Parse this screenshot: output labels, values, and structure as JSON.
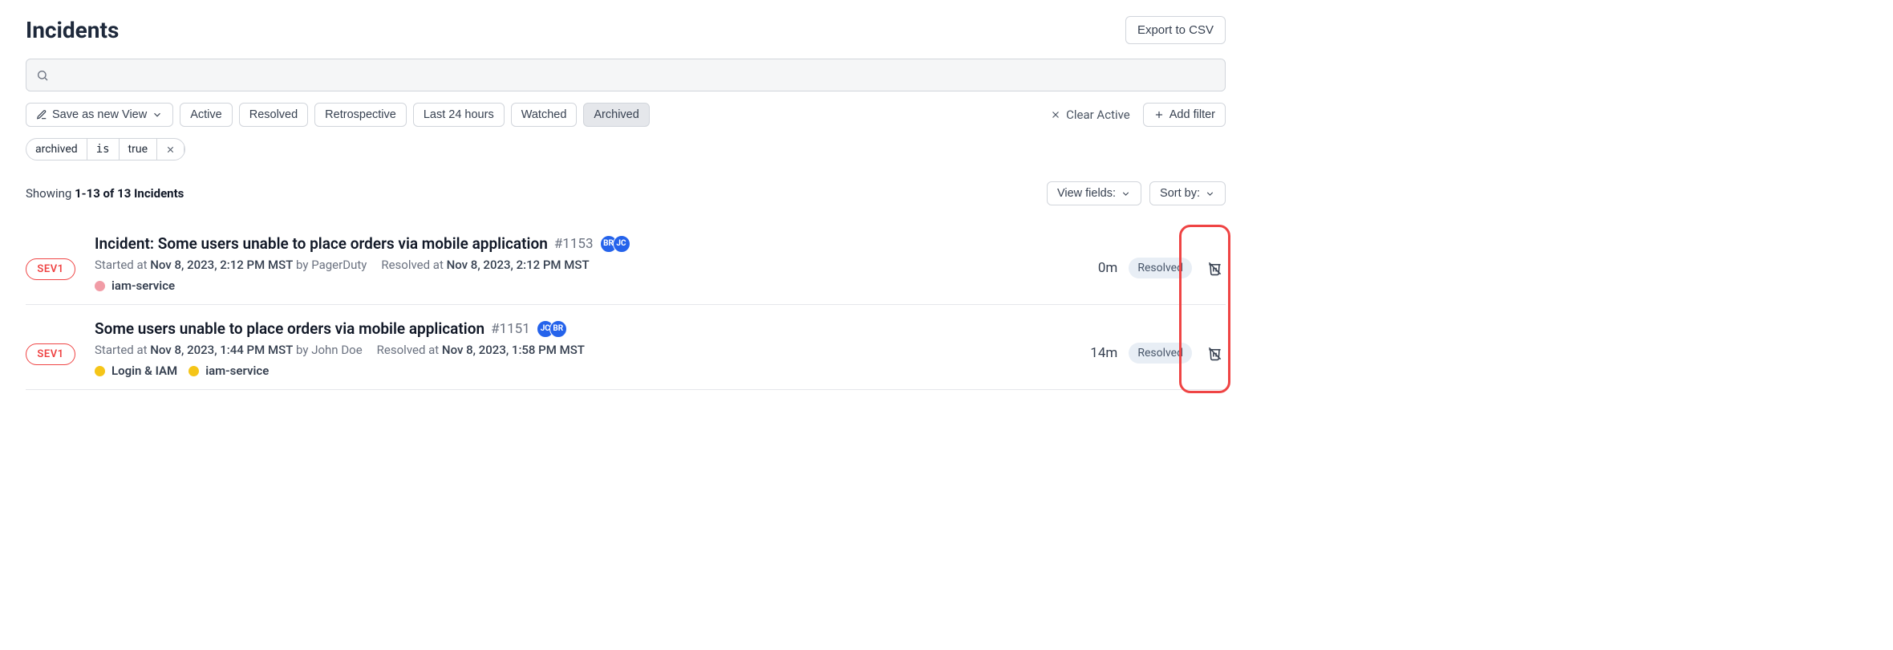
{
  "header": {
    "title": "Incidents",
    "export_label": "Export to CSV"
  },
  "search": {
    "placeholder": ""
  },
  "toolbar": {
    "save_view_label": "Save as new View",
    "preset_filters": [
      "Active",
      "Resolved",
      "Retrospective",
      "Last 24 hours",
      "Watched",
      "Archived"
    ],
    "active_preset_index": 5,
    "clear_label": "Clear Active",
    "add_filter_label": "Add filter"
  },
  "applied_filters": [
    {
      "field": "archived",
      "op": "is",
      "value": "true"
    }
  ],
  "results": {
    "showing_prefix": "Showing ",
    "range": "1-13 of 13 Incidents",
    "view_fields_label": "View fields:",
    "sort_by_label": "Sort by:"
  },
  "incidents": [
    {
      "severity": "SEV1",
      "title": "Incident: Some users unable to place orders via mobile application",
      "id": "#1153",
      "avatars": [
        {
          "initials": "BR",
          "color": "#2563eb"
        },
        {
          "initials": "JC",
          "color": "#2563eb"
        }
      ],
      "started_label": "Started at",
      "started_value": "Nov 8, 2023, 2:12 PM MST",
      "by_label": "by",
      "by_value": "PagerDuty",
      "resolved_label": "Resolved at",
      "resolved_value": "Nov 8, 2023, 2:12 PM MST",
      "tags": [
        {
          "label": "iam-service",
          "color": "#f19ca6"
        }
      ],
      "duration": "0m",
      "status": "Resolved"
    },
    {
      "severity": "SEV1",
      "title": "Some users unable to place orders via mobile application",
      "id": "#1151",
      "avatars": [
        {
          "initials": "JC",
          "color": "#2563eb"
        },
        {
          "initials": "BR",
          "color": "#2563eb"
        }
      ],
      "started_label": "Started at",
      "started_value": "Nov 8, 2023, 1:44 PM MST",
      "by_label": "by",
      "by_value": "John Doe",
      "resolved_label": "Resolved at",
      "resolved_value": "Nov 8, 2023, 1:58 PM MST",
      "tags": [
        {
          "label": "Login & IAM",
          "color": "#f5c518"
        },
        {
          "label": "iam-service",
          "color": "#f5c518"
        }
      ],
      "duration": "14m",
      "status": "Resolved"
    }
  ]
}
